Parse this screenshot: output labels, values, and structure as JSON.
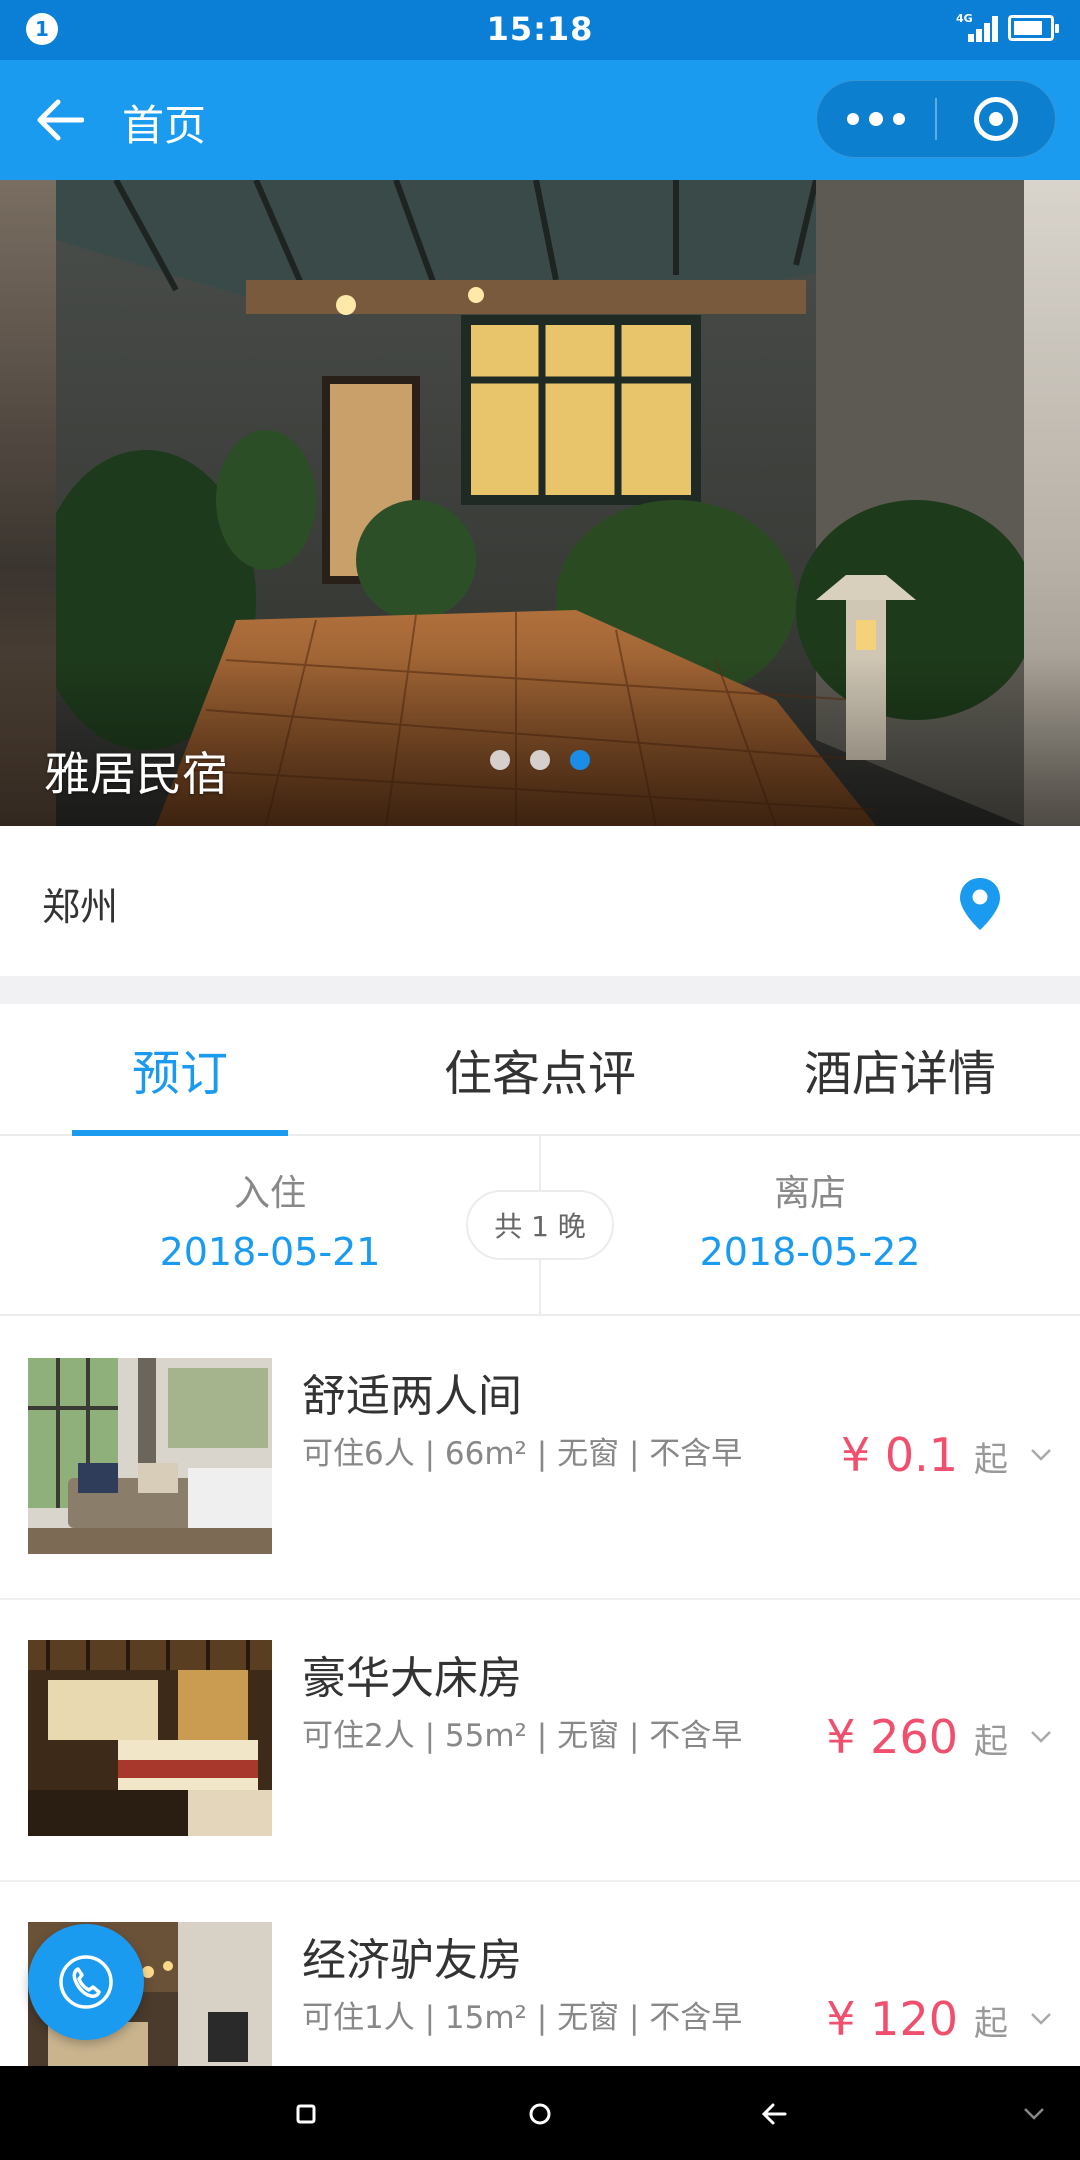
{
  "status_bar": {
    "notification_count": "1",
    "time": "15:18",
    "network": "4G"
  },
  "header": {
    "title": "首页",
    "icons": [
      "back-arrow-icon",
      "more-dots-icon",
      "target-icon"
    ]
  },
  "banner": {
    "title": "雅居民宿",
    "slide_count": 3,
    "active_slide": 3
  },
  "location": {
    "city": "郑州",
    "icon": "map-pin-icon"
  },
  "tabs": [
    {
      "label": "预订",
      "active": true
    },
    {
      "label": "住客点评",
      "active": false
    },
    {
      "label": "酒店详情",
      "active": false
    }
  ],
  "dates": {
    "checkin_label": "入住",
    "checkin_value": "2018-05-21",
    "checkout_label": "离店",
    "checkout_value": "2018-05-22",
    "nights_label": "共 1 晚"
  },
  "rooms": [
    {
      "name": "舒适两人间",
      "desc": "可住6人 | 66m² | 无窗 | 不含早",
      "price": "¥ 0.1",
      "suffix": "起"
    },
    {
      "name": "豪华大床房",
      "desc": "可住2人 | 55m² | 无窗 | 不含早",
      "price": "¥ 260",
      "suffix": "起"
    },
    {
      "name": "经济驴友房",
      "desc": "可住1人 | 15m² | 无窗 | 不含早",
      "price": "¥ 120",
      "suffix": "起"
    }
  ],
  "colors": {
    "primary": "#1a9bf0",
    "status_bar": "#0b7fd6",
    "price": "#f0506e",
    "nav_bar": "#000000"
  }
}
